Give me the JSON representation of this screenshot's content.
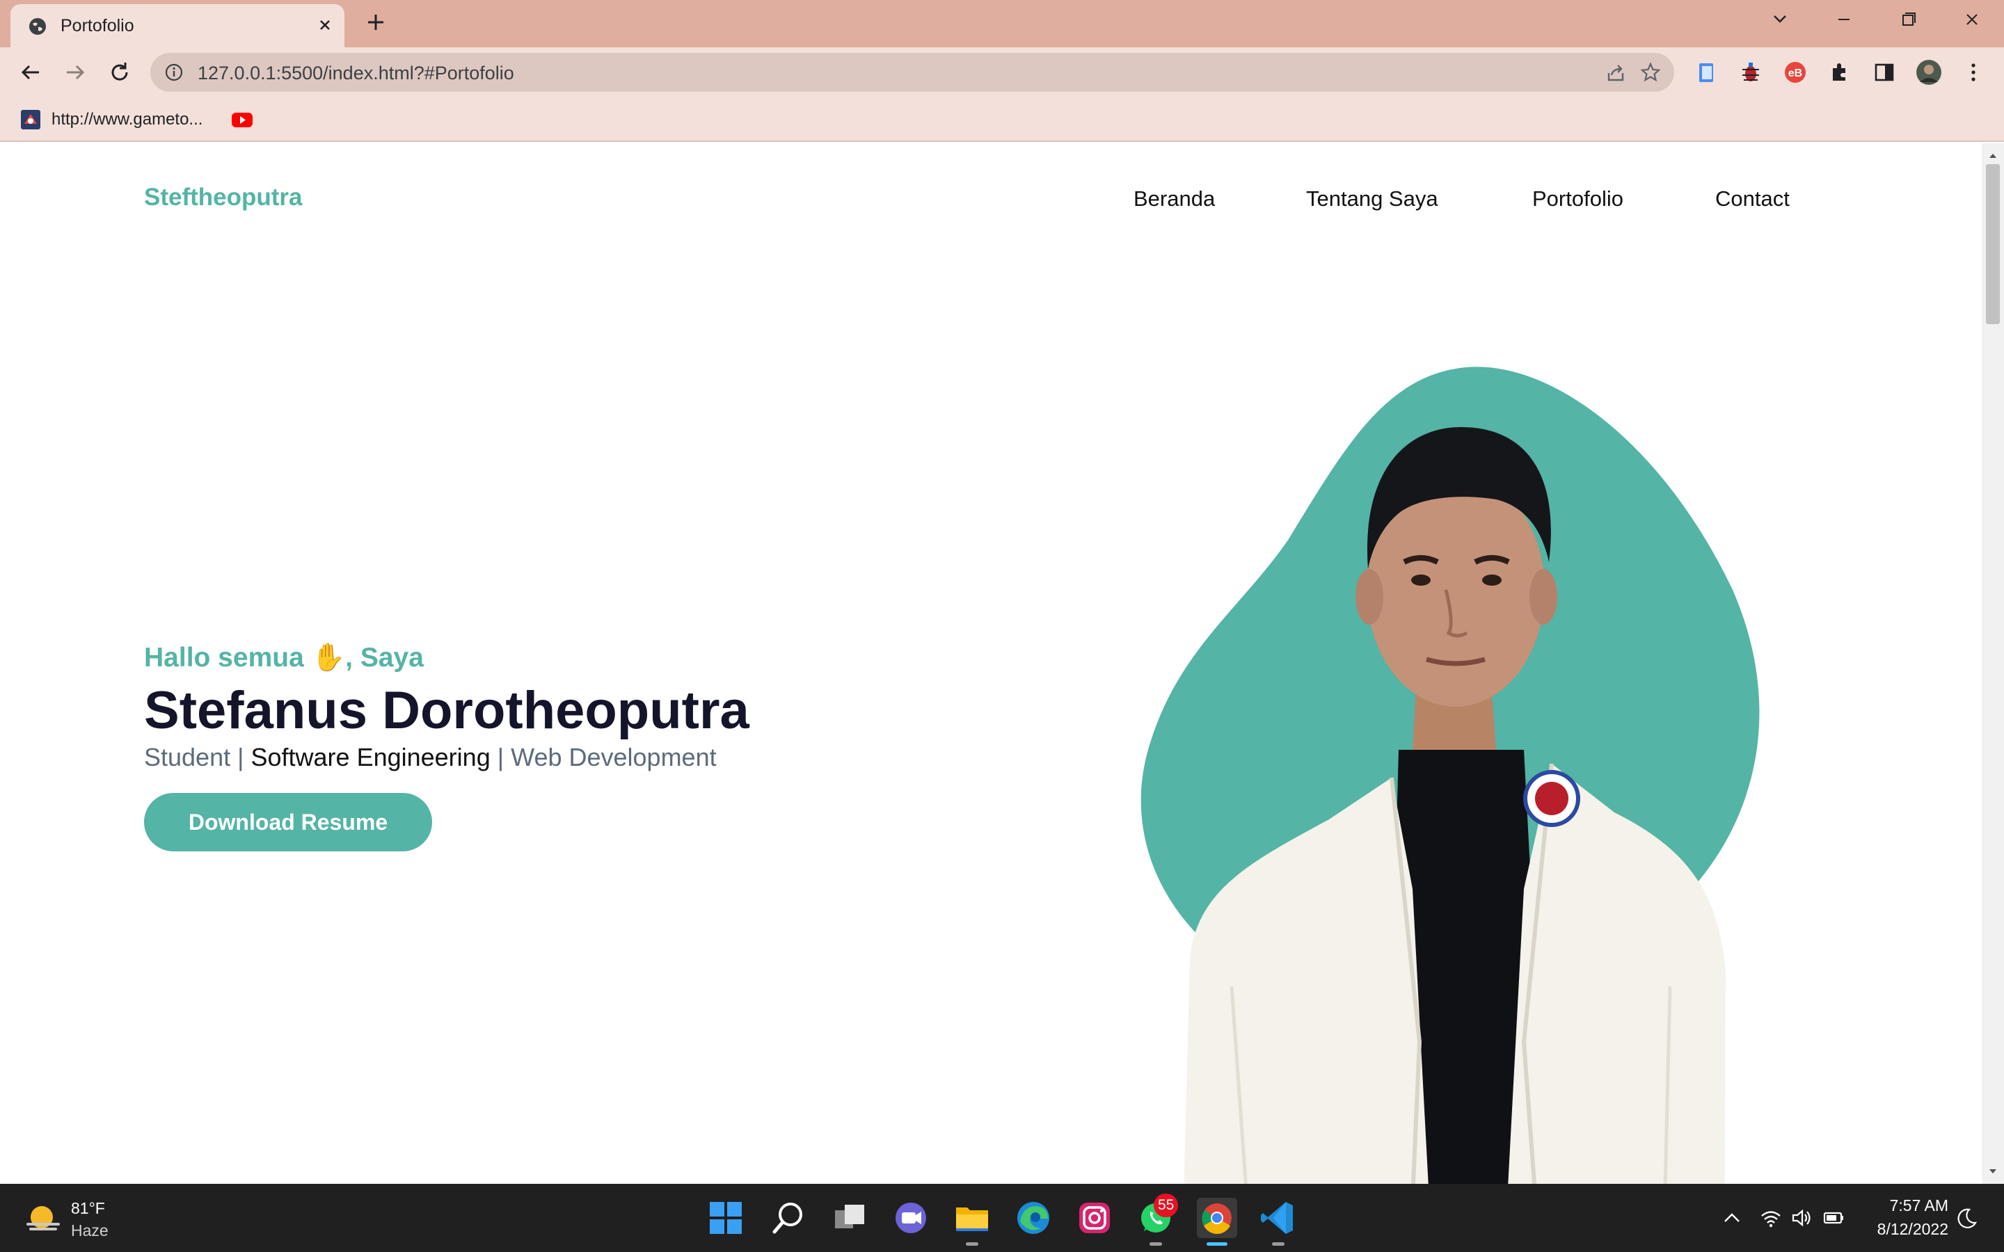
{
  "browser": {
    "tab_title": "Portofolio",
    "address": "127.0.0.1:5500/index.html?#Portofolio",
    "bookmarks": [
      {
        "label": "http://www.gameto...",
        "icon": "gametop-favicon-icon"
      },
      {
        "label": "",
        "icon": "youtube-icon"
      }
    ],
    "accent_color": "#dfae9e"
  },
  "site": {
    "brand": "Steftheoputra",
    "nav": [
      "Beranda",
      "Tentang Saya",
      "Portofolio",
      "Contact"
    ],
    "hero": {
      "greeting": "Hallo semua",
      "wave": "✋",
      "greeting_suffix": ", Saya",
      "name": "Stefanus Dorotheoputra",
      "role_1": "Student",
      "separator": "|",
      "role_2": "Software Engineering",
      "role_3": "Web Development",
      "cta": "Download Resume"
    },
    "colors": {
      "primary": "#54b4a5",
      "heading": "#14142b",
      "muted": "#5b6b7c"
    }
  },
  "taskbar": {
    "weather_temp": "81°F",
    "weather_cond": "Haze",
    "whatsapp_badge": "55",
    "time": "7:57 AM",
    "date": "8/12/2022",
    "apps": [
      "start-icon",
      "search-icon",
      "task-view-icon",
      "teams-chat-icon",
      "file-explorer-icon",
      "edge-icon",
      "instagram-icon",
      "whatsapp-icon",
      "chrome-icon",
      "vscode-icon"
    ]
  }
}
